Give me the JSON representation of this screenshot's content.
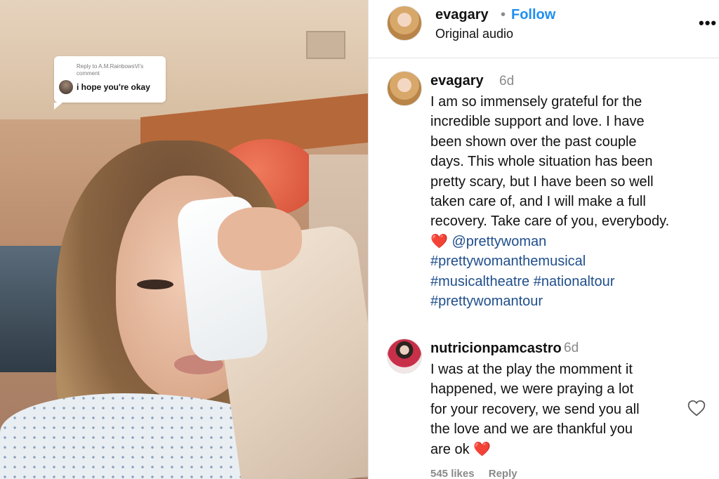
{
  "media": {
    "reply_meta_line1": "Reply to A.M.RainbowsVi's",
    "reply_meta_line2": "comment",
    "reply_text": "i hope you're okay"
  },
  "header": {
    "username": "evagary",
    "separator": "•",
    "follow_label": "Follow",
    "audio_label": "Original audio",
    "more_icon": "•••"
  },
  "caption": {
    "username": "evagary",
    "time": "6d",
    "lines": [
      "I am so immensely grateful for the",
      "incredible support and love. I have",
      "been shown over the past couple",
      "days. This whole situation has been",
      "pretty scary, but I have been so well",
      "taken care of, and I will make a full",
      "recovery. Take care of you, everybody."
    ],
    "heart_emoji": "❤️",
    "mention": "@prettywoman",
    "hashtag1": "#prettywomanthemusical",
    "hashtag2": "#musicaltheatre",
    "hashtag3": "#nationaltour",
    "hashtag4": "#prettywomantour"
  },
  "comment": {
    "username": "nutricionpamcastro",
    "time": "6d",
    "lines": [
      "I was at the play the momment it",
      "happened, we were praying a lot",
      "for your recovery, we send you all",
      "the love and we are thankful you"
    ],
    "last_line_text": "are ok",
    "heart_emoji": "❤️",
    "likes": "545 likes",
    "reply_label": "Reply"
  },
  "colors": {
    "follow": "#1e8ff0",
    "hashtag": "#1f4e8c",
    "muted": "#8a8a8a"
  }
}
